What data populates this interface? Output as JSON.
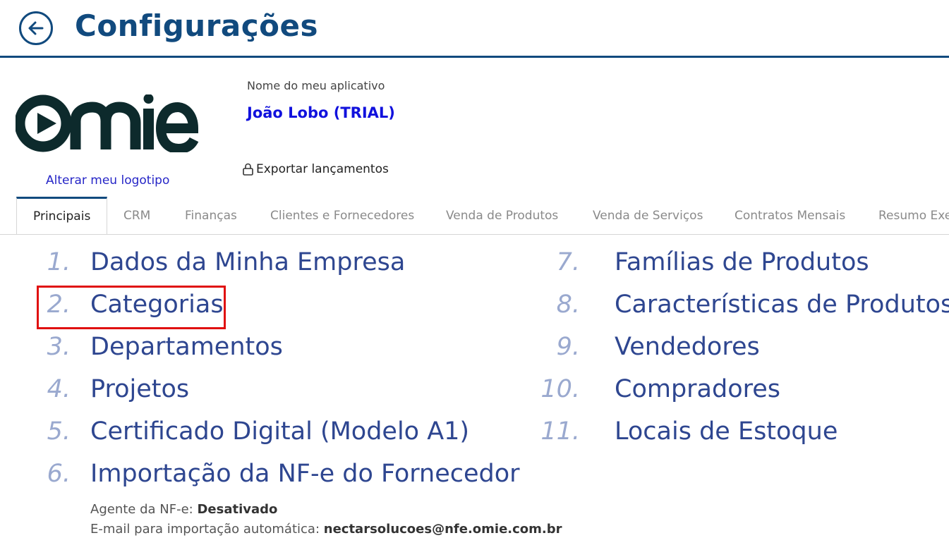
{
  "header": {
    "title": "Configurações"
  },
  "logo": {
    "change_link": "Alterar meu logotipo"
  },
  "app": {
    "caption": "Nome do meu aplicativo",
    "name": "João Lobo (TRIAL)",
    "export_label": "Exportar lançamentos"
  },
  "tabs": [
    {
      "label": "Principais"
    },
    {
      "label": "CRM"
    },
    {
      "label": "Finanças"
    },
    {
      "label": "Clientes e Fornecedores"
    },
    {
      "label": "Venda de Produtos"
    },
    {
      "label": "Venda de Serviços"
    },
    {
      "label": "Contratos Mensais"
    },
    {
      "label": "Resumo Executivo"
    }
  ],
  "left_list": [
    {
      "num": "1.",
      "label": "Dados da Minha Empresa"
    },
    {
      "num": "2.",
      "label": "Categorias"
    },
    {
      "num": "3.",
      "label": "Departamentos"
    },
    {
      "num": "4.",
      "label": "Projetos"
    },
    {
      "num": "5.",
      "label": "Certificado Digital (Modelo A1)"
    },
    {
      "num": "6.",
      "label": "Importação da NF-e do Fornecedor"
    }
  ],
  "right_list": [
    {
      "num": "7.",
      "label": "Famílias de Produtos"
    },
    {
      "num": "8.",
      "label": "Características de Produtos"
    },
    {
      "num": "9.",
      "label": "Vendedores"
    },
    {
      "num": "10.",
      "label": "Compradores"
    },
    {
      "num": "11.",
      "label": "Locais de Estoque"
    }
  ],
  "nfe": {
    "agent_label": "Agente da NF-e:",
    "agent_value": "Desativado",
    "email_label": "E-mail para importação automática:",
    "email_value": "nectarsolucoes@nfe.omie.com.br"
  },
  "colors": {
    "primary": "#114a7e",
    "list_text": "#2e4690",
    "highlight": "#e01010"
  },
  "icons": {
    "back": "arrow-left-circle-icon",
    "lock": "lock-icon"
  }
}
